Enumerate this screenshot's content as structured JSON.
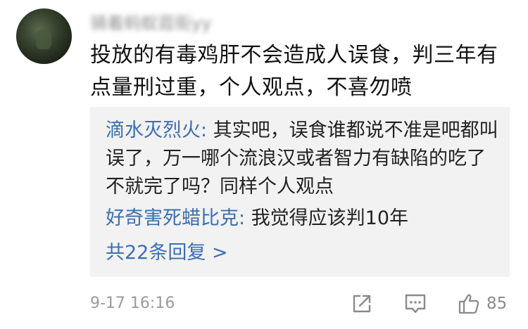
{
  "post": {
    "author": "骑着蚂蚁逛街yy",
    "text": "投放的有毒鸡肝不会造成人误食，判三年有点量刑过重，个人观点，不喜勿喷",
    "time": "9-17 16:16",
    "like_count": "85"
  },
  "replies": [
    {
      "name": "滴水灭烈火",
      "sep": ": ",
      "text": "其实吧，误食谁都说不准是吧都叫误了，万一哪个流浪汉或者智力有缺陷的吃了不就完了吗？同样个人观点"
    },
    {
      "name": "好奇害死蜡比克",
      "sep": ": ",
      "text": "我觉得应该判10年"
    }
  ],
  "more_replies_label": "共22条回复 >",
  "icons": {
    "share": "share-icon",
    "comment": "comment-icon",
    "like": "thumbs-up-icon"
  },
  "colors": {
    "link_blue": "#3b6fb0",
    "reply_bg": "#f2f2f2",
    "muted_gray": "#9b9b9b"
  }
}
